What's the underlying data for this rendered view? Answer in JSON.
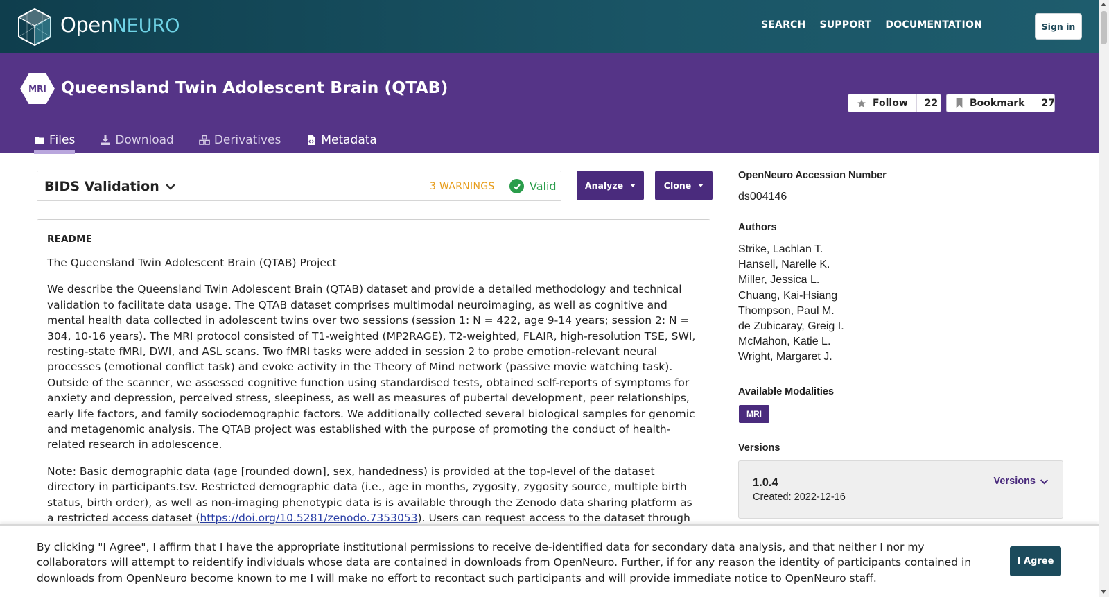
{
  "nav": {
    "brand_open": "Open",
    "brand_neuro": "NEURO",
    "links": [
      "SEARCH",
      "SUPPORT",
      "DOCUMENTATION"
    ],
    "sign_in": "Sign in"
  },
  "dataset": {
    "modality_badge": "MRI",
    "title": "Queensland Twin Adolescent Brain (QTAB)",
    "follow_label": "Follow",
    "follow_count": "22",
    "bookmark_label": "Bookmark",
    "bookmark_count": "27",
    "tabs": [
      {
        "label": "Files",
        "icon": "folder-icon",
        "active": true
      },
      {
        "label": "Download",
        "icon": "download-icon",
        "active": false
      },
      {
        "label": "Derivatives",
        "icon": "cubes-icon",
        "active": false
      },
      {
        "label": "Metadata",
        "icon": "file-code-icon",
        "active": false
      }
    ]
  },
  "validation": {
    "title": "BIDS Validation",
    "warnings": "3 WARNINGS",
    "status": "Valid",
    "warning_color": "#e79d1c",
    "valid_color": "#2a9d4b"
  },
  "actions": {
    "analyze": "Analyze",
    "clone": "Clone"
  },
  "readme": {
    "heading": "README",
    "p1": "The Queensland Twin Adolescent Brain (QTAB) Project",
    "p2": "We describe the Queensland Twin Adolescent Brain (QTAB) dataset and provide a detailed methodology and technical validation to facilitate data usage. The QTAB dataset comprises multimodal neuroimaging, as well as cognitive and mental health data collected in adolescent twins over two sessions (session 1: N = 422, age 9-14 years; session 2: N = 304, 10-16 years). The MRI protocol consisted of T1-weighted (MP2RAGE), T2-weighted, FLAIR, high-resolution TSE, SWI, resting-state fMRI, DWI, and ASL scans. Two fMRI tasks were added in session 2 to probe emotion-relevant neural processes (emotional conflict task) and evoke activity in the Theory of Mind network (passive movie watching task). Outside of the scanner, we assessed cognitive function using standardised tests, obtained self-reports of symptoms for anxiety and depression, perceived stress, sleepiness, as well as measures of pubertal development, peer relationships, early life factors, and family sociodemographic factors. We additionally collected several biological samples for genomic and metagenomic analysis. The QTAB project was established with the purpose of promoting the conduct of health-related research in adolescence.",
    "p3_before": "Note: Basic demographic data (age [rounded down], sex, handedness) is provided at the top-level of the dataset directory in participants.tsv. Restricted demographic data (i.e., age in months, zygosity, zygosity source, multiple birth status, birth order), as well as non-imaging phenotypic data is is available through the Zenodo data sharing platform as a restricted access dataset (",
    "p3_link": "https://doi.org/10.5281/zenodo.7353053",
    "p3_after": "). Users can request access to the dataset through the Zenodo platform. Applicants are required to complete and abide by a data usage agreement."
  },
  "sidebar": {
    "accession_label": "OpenNeuro Accession Number",
    "accession": "ds004146",
    "authors_label": "Authors",
    "authors": [
      "Strike, Lachlan T.",
      "Hansell, Narelle K.",
      "Miller, Jessica L.",
      "Chuang, Kai-Hsiang",
      "Thompson, Paul M.",
      "de Zubicaray, Greig I.",
      "McMahon, Katie L.",
      "Wright, Margaret J."
    ],
    "modalities_label": "Available Modalities",
    "modality": "MRI",
    "versions_label": "Versions",
    "version": "1.0.4",
    "version_created": "Created: 2022-12-16",
    "versions_button": "Versions"
  },
  "agreement": {
    "text": "By clicking \"I Agree\", I affirm that I have the appropriate institutional permissions to receive de-identified data for secondary data analysis, and that neither I nor my collaborators will attempt to reidentify individuals whose data are contained in downloads from OpenNeuro. Further, if for any reason the identity of participants contained in downloads from OpenNeuro become known to me I will make no effort to recontact such participants and will provide immediate notice to OpenNeuro staff.",
    "button": "I Agree"
  },
  "colors": {
    "nav_bg": "#1a5566",
    "header_purple": "#553487",
    "button_purple": "#4a2b7d",
    "agree_button": "#1c4b5c"
  }
}
